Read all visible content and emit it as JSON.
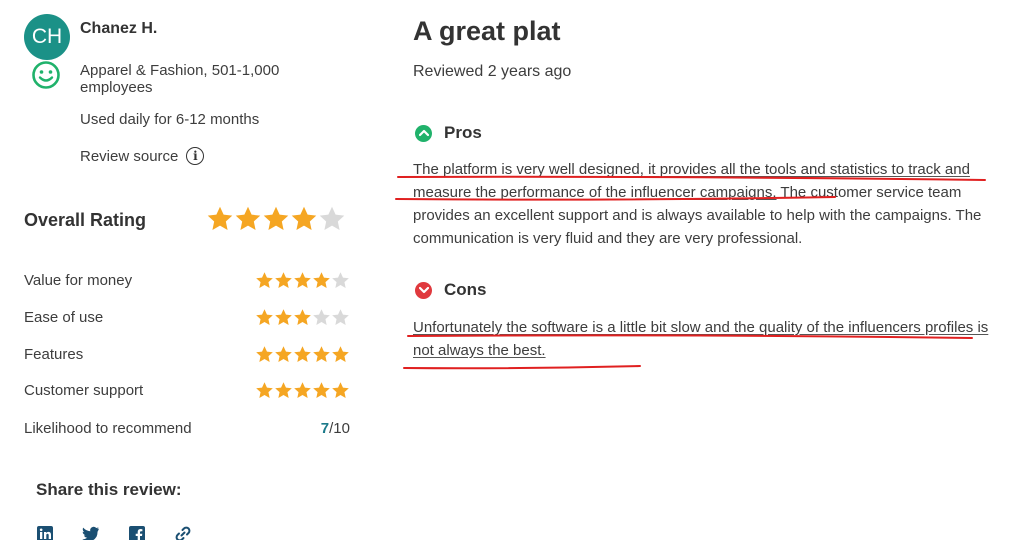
{
  "reviewer": {
    "initials": "CH",
    "name": "Chanez H.",
    "company": "Apparel & Fashion, 501-1,000 employees",
    "usage": "Used daily for 6-12 months",
    "source_label": "Review source",
    "info_glyph": "i"
  },
  "ratings": {
    "overall_label": "Overall Rating",
    "overall_stars": 4,
    "rows": [
      {
        "label": "Value for money",
        "stars": 4
      },
      {
        "label": "Ease of use",
        "stars": 3
      },
      {
        "label": "Features",
        "stars": 5
      },
      {
        "label": "Customer support",
        "stars": 5
      }
    ],
    "recommend_label": "Likelihood to recommend",
    "recommend_value": "7",
    "recommend_suffix": "/10"
  },
  "share": {
    "title": "Share this review:",
    "icons": [
      "linkedin-icon",
      "twitter-icon",
      "facebook-icon",
      "link-icon"
    ]
  },
  "review": {
    "title": "A great plat",
    "reviewed": "Reviewed 2 years ago",
    "pros_label": "Pros",
    "pros_text_highlight": "The platform is very well designed, it provides all the tools and statistics to track and measure the performance of the influencer campaigns.",
    "pros_text_rest": " The customer service team provides an excellent support and is always available to help with the campaigns. The communication is very fluid and they are very professional.",
    "cons_label": "Cons",
    "cons_text": "Unfortunately the software is a little bit slow and the quality of the influencers profiles is not always the best."
  },
  "colors": {
    "star_filled": "#f5a623",
    "star_empty": "#d9d9d9",
    "pros_green": "#20b26b",
    "cons_red": "#e0393e",
    "annotation_red": "#e02020",
    "avatar_teal": "#1b9187"
  }
}
